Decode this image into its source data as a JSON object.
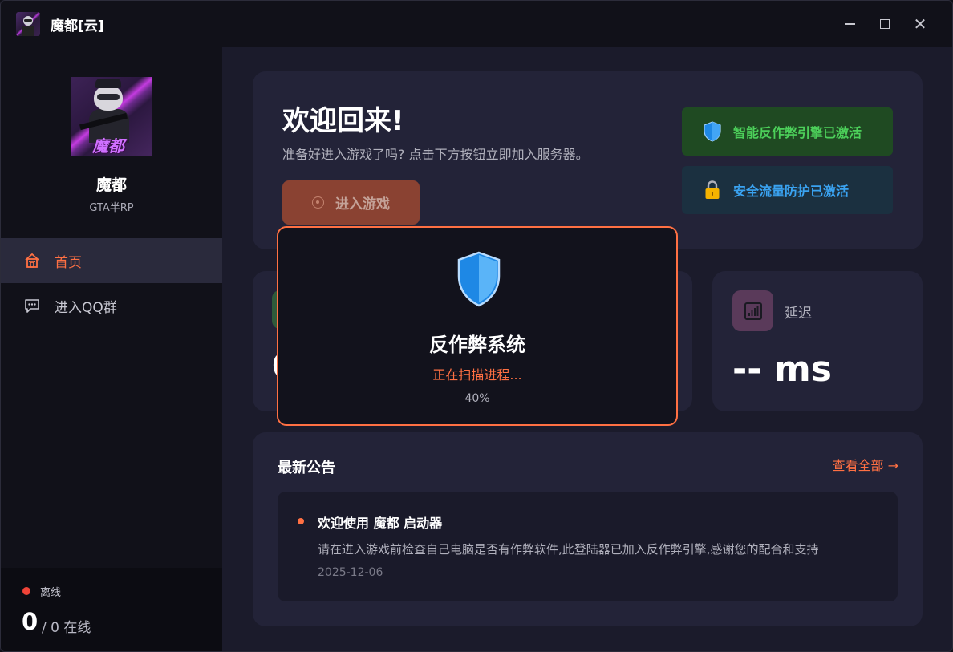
{
  "app": {
    "title": "魔都[云]"
  },
  "window_controls": {
    "minimize": "minimize",
    "maximize": "maximize",
    "close": "close"
  },
  "sidebar": {
    "server_name": "魔都",
    "server_subtitle": "GTA半RP",
    "avatar_text": "魔都",
    "nav": [
      {
        "label": "首页",
        "icon": "home-icon",
        "active": true
      },
      {
        "label": "进入QQ群",
        "icon": "chat-icon",
        "active": false
      }
    ],
    "status": {
      "label": "离线",
      "color": "#f04438"
    },
    "online": {
      "count": "0",
      "total_text": "/ 0 在线"
    }
  },
  "welcome": {
    "title": "欢迎回来!",
    "subtitle": "准备好进入游戏了吗? 点击下方按钮立即加入服务器。",
    "play_button": "进入游戏",
    "badges": [
      {
        "label": "智能反作弊引擎已激活",
        "icon": "shield-icon",
        "color": "#4cd05a"
      },
      {
        "label": "安全流量防护已激活",
        "icon": "lock-icon",
        "color": "#3aa2f0"
      }
    ]
  },
  "stats": {
    "left_value": "0",
    "latency": {
      "label": "延迟",
      "value": "-- ms",
      "icon": "signal-icon"
    }
  },
  "news": {
    "title": "最新公告",
    "view_all": "查看全部 →",
    "items": [
      {
        "title": "欢迎使用 魔都 启动器",
        "body": "请在进入游戏前检查自己电脑是否有作弊软件,此登陆器已加入反作弊引擎,感谢您的配合和支持",
        "date": "2025-12-06"
      }
    ]
  },
  "modal": {
    "title": "反作弊系统",
    "status": "正在扫描进程...",
    "progress": "40%",
    "progress_value": 0.4,
    "accent": "#ff7043"
  }
}
